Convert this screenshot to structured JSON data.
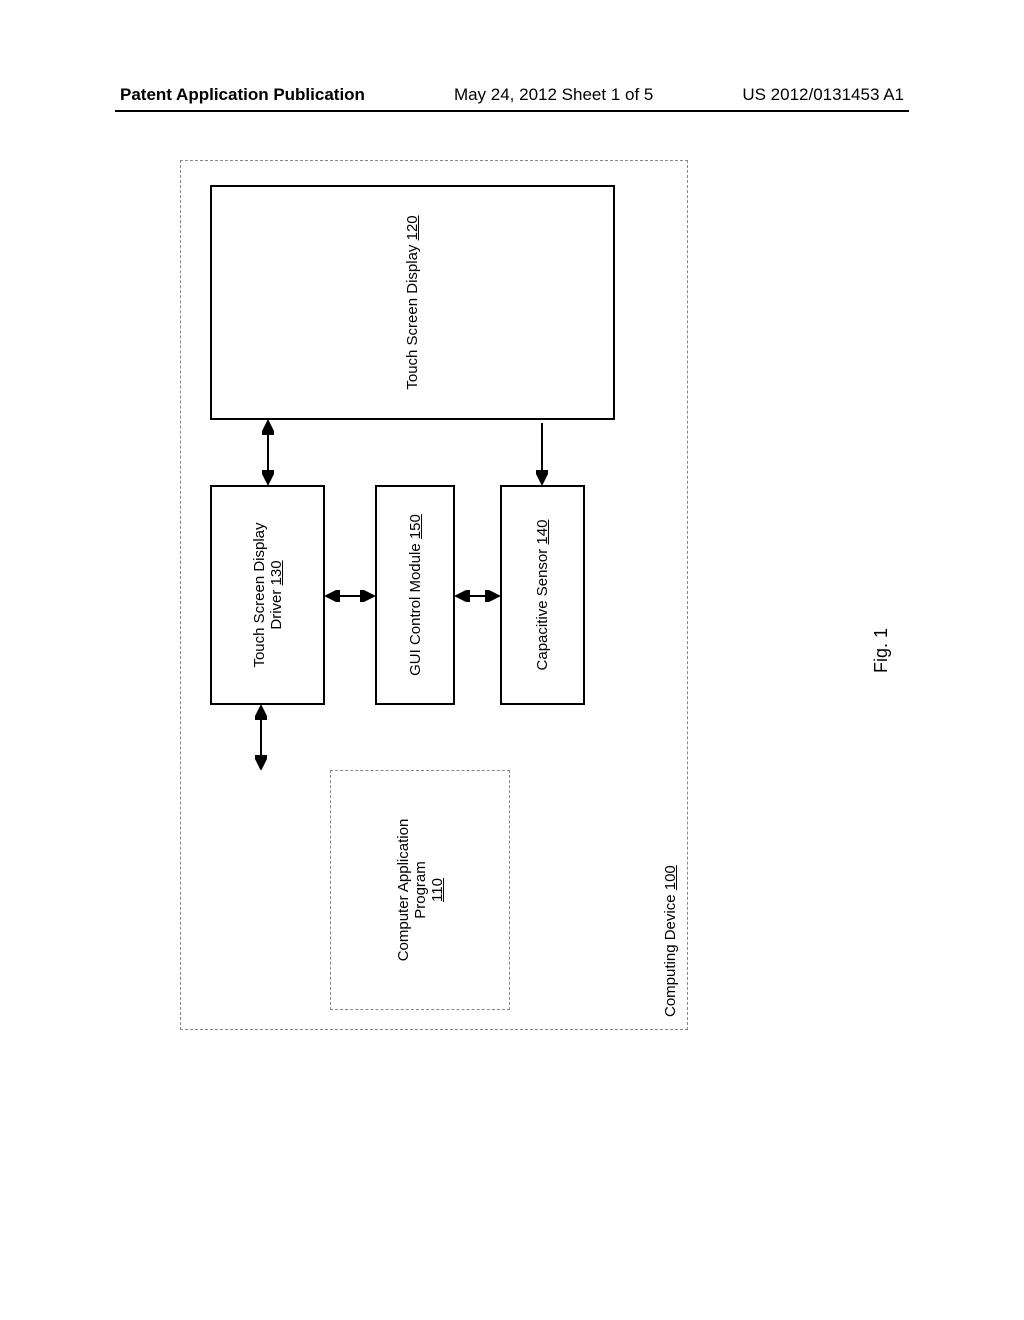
{
  "header": {
    "left": "Patent Application Publication",
    "center": "May 24, 2012  Sheet 1 of 5",
    "right": "US 2012/0131453 A1"
  },
  "figure_label": "Fig. 1",
  "device": {
    "label": "Computing Device",
    "ref": "100"
  },
  "boxes": {
    "app": {
      "line1": "Computer Application",
      "line2": "Program",
      "ref": "110"
    },
    "driver": {
      "line1": "Touch Screen Display",
      "line2": "Driver",
      "ref": "130"
    },
    "gui": {
      "line1": "GUI Control Module",
      "ref": "150"
    },
    "sensor": {
      "line1": "Capacitive Sensor",
      "ref": "140"
    },
    "display": {
      "line1": "Touch Screen Display",
      "ref": "120"
    }
  }
}
